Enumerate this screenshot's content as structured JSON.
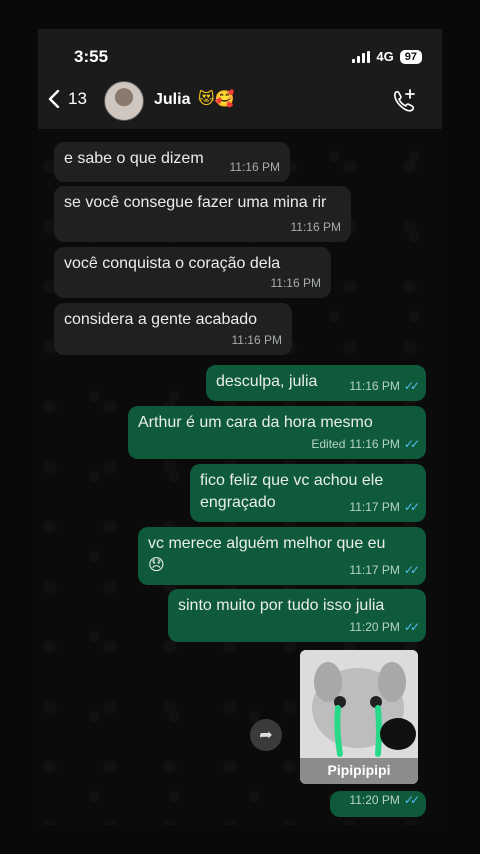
{
  "status": {
    "time": "3:55",
    "network": "4G",
    "battery": "97"
  },
  "header": {
    "back_count": "13",
    "name": "Julia",
    "emojis": "😻🥰"
  },
  "messages": [
    {
      "dir": "in",
      "text": "e sabe o que dizem",
      "time": "11:16 PM"
    },
    {
      "dir": "in",
      "text": "se você consegue fazer uma mina rir",
      "time": "11:16 PM"
    },
    {
      "dir": "in",
      "text": "você conquista o coração dela",
      "time": "11:16 PM"
    },
    {
      "dir": "in",
      "text": "considera a gente acabado",
      "time": "11:16 PM"
    },
    {
      "dir": "out",
      "text": "desculpa, julia",
      "time": "11:16 PM"
    },
    {
      "dir": "out",
      "text": "Arthur é um cara da hora mesmo",
      "edited": "Edited",
      "time": "11:16 PM"
    },
    {
      "dir": "out",
      "text": "fico feliz que vc achou ele engraçado",
      "time": "11:17 PM"
    },
    {
      "dir": "out",
      "text": "vc merece alguém melhor que eu",
      "emoji": "😞",
      "time": "11:17 PM"
    },
    {
      "dir": "out",
      "text": "sinto muito por tudo isso julia",
      "time": "11:20 PM"
    }
  ],
  "sticker": {
    "caption": "Pipipipipi",
    "time": "11:20 PM"
  },
  "icons": {
    "back": "chevron-left-icon",
    "call": "add-call-icon",
    "forward": "forward-icon",
    "ticks": "double-check-icon"
  }
}
